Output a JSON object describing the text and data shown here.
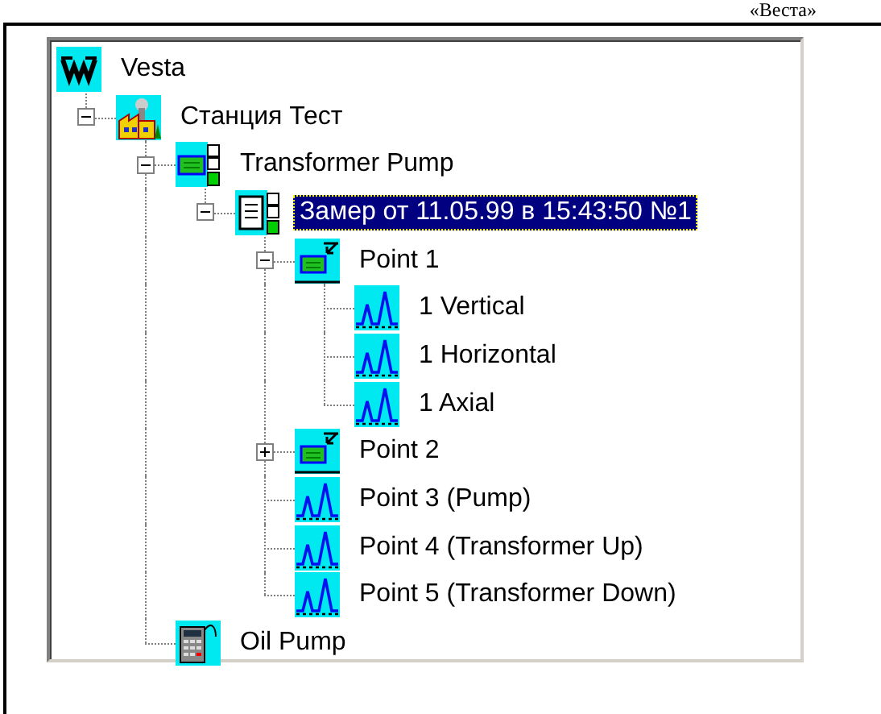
{
  "caption": "«Веста»",
  "tree": [
    {
      "label": "Vesta",
      "kind": "logo",
      "selected": false,
      "children": [
        {
          "label": "Станция Тест",
          "kind": "station",
          "selected": false,
          "expanded": true,
          "children": [
            {
              "label": "Transformer Pump",
              "kind": "machine",
              "selected": false,
              "expanded": true,
              "children": [
                {
                  "label": "Замер от 11.05.99 в 15:43:50 №1",
                  "kind": "measurement",
                  "selected": true,
                  "expanded": true,
                  "children": [
                    {
                      "label": "Point 1",
                      "kind": "point",
                      "selected": false,
                      "expanded": true,
                      "children": [
                        {
                          "label": "1 Vertical",
                          "kind": "spectrum",
                          "selected": false
                        },
                        {
                          "label": "1 Horizontal",
                          "kind": "spectrum",
                          "selected": false
                        },
                        {
                          "label": "1 Axial",
                          "kind": "spectrum",
                          "selected": false
                        }
                      ]
                    },
                    {
                      "label": "Point 2",
                      "kind": "point",
                      "selected": false,
                      "expanded": false
                    },
                    {
                      "label": "Point 3 (Pump)",
                      "kind": "spectrum",
                      "selected": false
                    },
                    {
                      "label": "Point 4 (Transformer Up)",
                      "kind": "spectrum",
                      "selected": false
                    },
                    {
                      "label": "Point 5 (Transformer Down)",
                      "kind": "spectrum",
                      "selected": false
                    }
                  ]
                }
              ]
            },
            {
              "label": "Oil Pump",
              "kind": "device",
              "selected": false
            }
          ]
        }
      ]
    }
  ]
}
